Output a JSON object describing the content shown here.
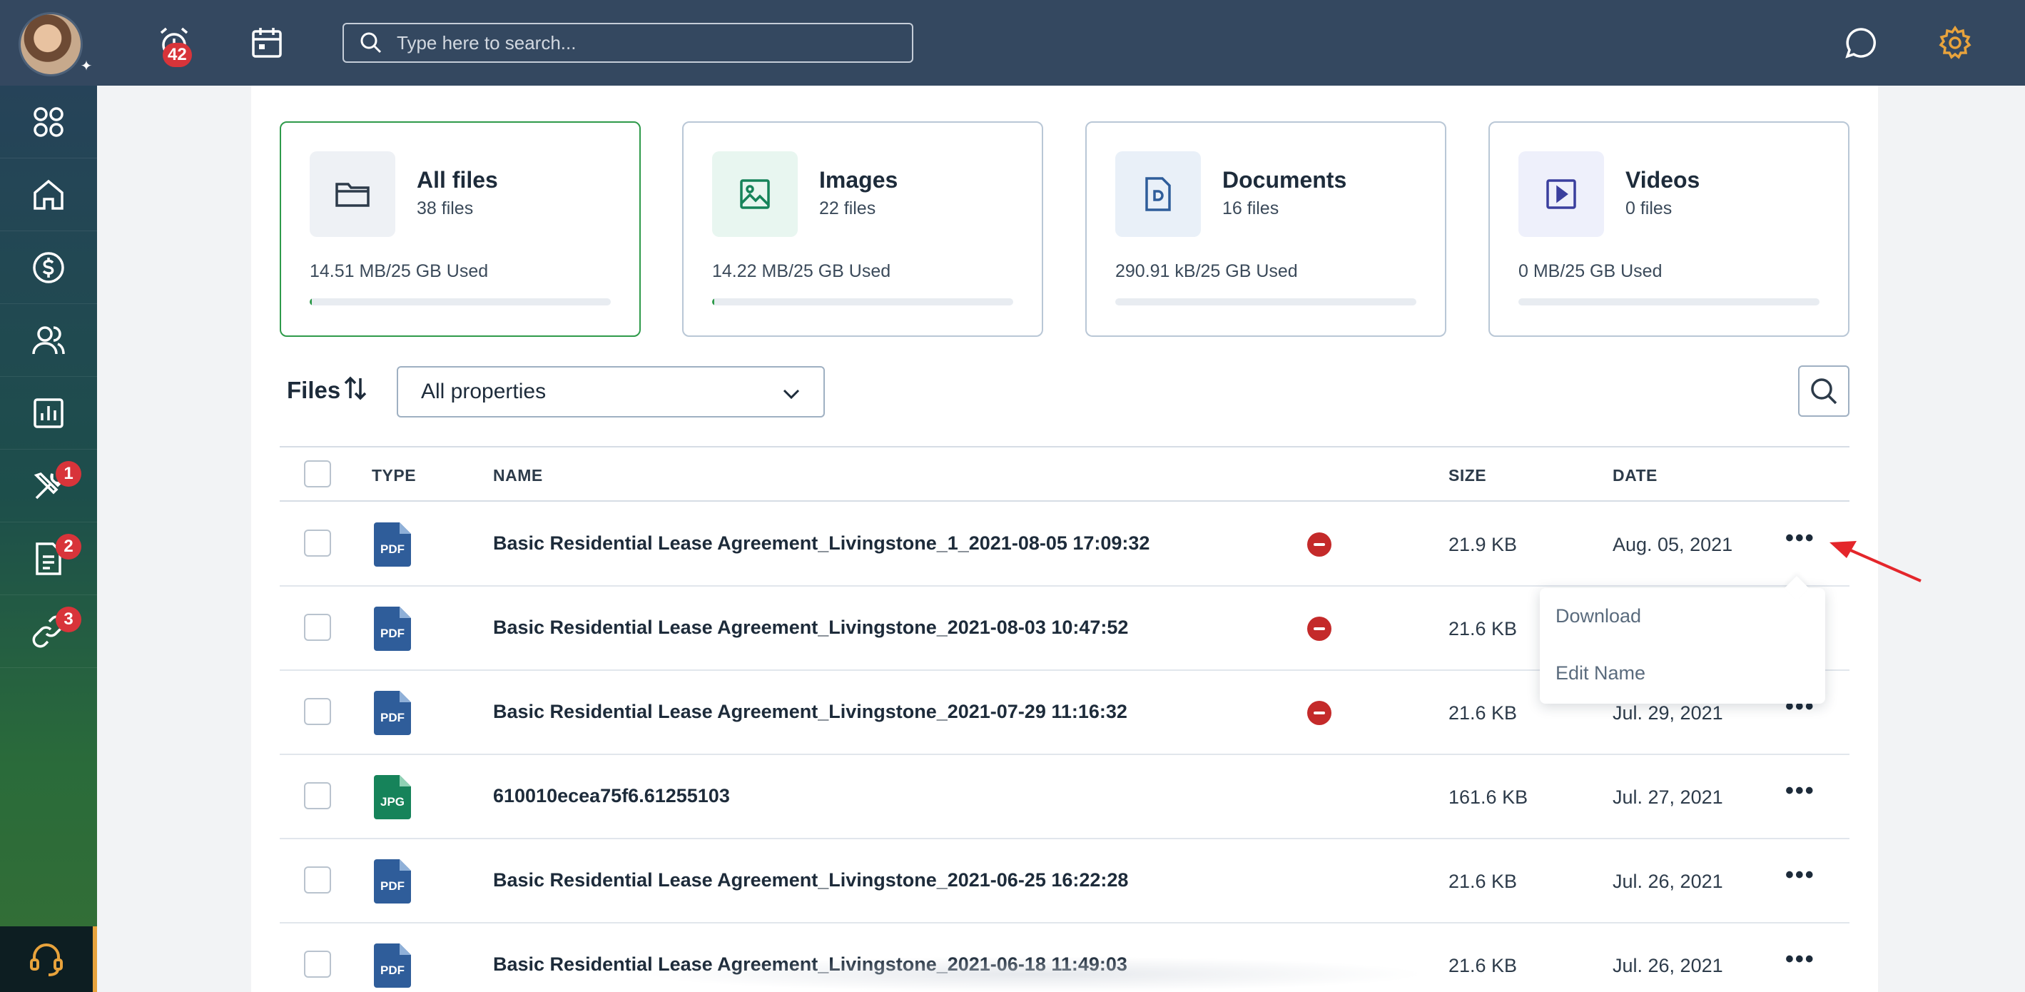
{
  "topbar": {
    "notifications_count": "42",
    "search_placeholder": "Type here to search..."
  },
  "sidebar": {
    "items": [
      {
        "icon": "apps-grid-icon"
      },
      {
        "icon": "home-icon"
      },
      {
        "icon": "dollar-icon"
      },
      {
        "icon": "users-icon"
      },
      {
        "icon": "reports-icon"
      },
      {
        "icon": "tools-icon",
        "badge": "1"
      },
      {
        "icon": "document-icon",
        "badge": "2"
      },
      {
        "icon": "link-icon",
        "badge": "3"
      }
    ],
    "support_icon": "headset-icon"
  },
  "cards": [
    {
      "title": "All files",
      "count": "38 files",
      "used": "14.51 MB/25 GB Used",
      "fill": 0.006,
      "icon": "folder-icon"
    },
    {
      "title": "Images",
      "count": "22 files",
      "used": "14.22 MB/25 GB Used",
      "fill": 0.006,
      "icon": "image-icon"
    },
    {
      "title": "Documents",
      "count": "16 files",
      "used": "290.91 kB/25 GB Used",
      "fill": 0.0,
      "icon": "document-file-icon"
    },
    {
      "title": "Videos",
      "count": "0 files",
      "used": "0 MB/25 GB Used",
      "fill": 0.0,
      "icon": "video-icon"
    }
  ],
  "toolbar": {
    "files_label": "Files",
    "filter_value": "All properties"
  },
  "table": {
    "headers": {
      "type": "TYPE",
      "name": "NAME",
      "size": "SIZE",
      "date": "DATE"
    },
    "rows": [
      {
        "type": "PDF",
        "name": "Basic Residential Lease Agreement_Livingstone_1_2021-08-05 17:09:32",
        "removable": true,
        "size": "21.9 KB",
        "date": "Aug. 05, 2021"
      },
      {
        "type": "PDF",
        "name": "Basic Residential Lease Agreement_Livingstone_2021-08-03 10:47:52",
        "removable": true,
        "size": "21.6 KB",
        "date": ""
      },
      {
        "type": "PDF",
        "name": "Basic Residential Lease Agreement_Livingstone_2021-07-29 11:16:32",
        "removable": true,
        "size": "21.6 KB",
        "date": "Jul. 29, 2021"
      },
      {
        "type": "JPG",
        "name": "610010ecea75f6.61255103",
        "removable": false,
        "size": "161.6 KB",
        "date": "Jul. 27, 2021"
      },
      {
        "type": "PDF",
        "name": "Basic Residential Lease Agreement_Livingstone_2021-06-25 16:22:28",
        "removable": false,
        "size": "21.6 KB",
        "date": "Jul. 26, 2021"
      },
      {
        "type": "PDF",
        "name": "Basic Residential Lease Agreement_Livingstone_2021-06-18 11:49:03",
        "removable": false,
        "size": "21.6 KB",
        "date": "Jul. 26, 2021"
      }
    ]
  },
  "context_menu": {
    "items": [
      "Download",
      "Edit Name"
    ]
  },
  "colors": {
    "topbar": "#344860",
    "accent_green": "#2e9a4a",
    "badge_red": "#d8343a",
    "pdf_blue": "#2f5d9a",
    "jpg_green": "#16835a",
    "settings_orange": "#e8a33c"
  }
}
